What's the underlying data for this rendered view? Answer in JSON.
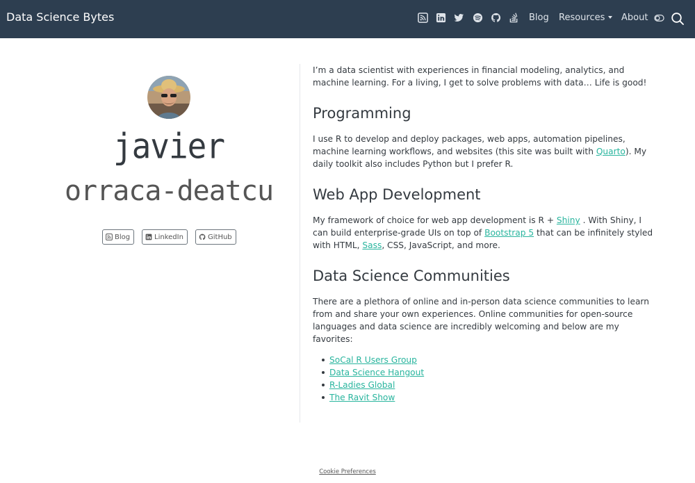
{
  "navbar": {
    "brand": "Data Science Bytes",
    "icons": [
      "rss-icon",
      "linkedin-icon",
      "twitter-icon",
      "spotify-icon",
      "github-icon",
      "stackoverflow-icon"
    ],
    "blog_label": "Blog",
    "resources_label": "Resources",
    "about_label": "About"
  },
  "profile": {
    "first_name": "javier",
    "last_name": "orraca-deatcu",
    "links": [
      {
        "label": "Blog",
        "icon": "rss-icon"
      },
      {
        "label": "LinkedIn",
        "icon": "linkedin-icon"
      },
      {
        "label": "GitHub",
        "icon": "github-icon"
      }
    ]
  },
  "content": {
    "intro": "I’m a data scientist with experiences in financial modeling, analytics, and machine learning. For a living, I get to solve problems with data… Life is good!",
    "programming": {
      "heading": "Programming",
      "text_before": "I use R to develop and deploy packages, web apps, automation pipelines, machine learning workflows, and websites (this site was built with ",
      "link": "Quarto",
      "text_after": "). My daily toolkit also includes Python but I prefer R."
    },
    "webapp": {
      "heading": "Web App Development",
      "text_1": "My framework of choice for web app development is R + ",
      "link_shiny": "Shiny",
      "text_2": " . With Shiny, I can build enterprise-grade UIs on top of ",
      "link_bootstrap": "Bootstrap 5",
      "text_3": " that can be infinitely styled with HTML, ",
      "link_sass": "Sass",
      "text_4": ", CSS, JavaScript, and more."
    },
    "communities": {
      "heading": "Data Science Communities",
      "text": "There are a plethora of online and in-person data science communities to learn from and share your own experiences. Online communities for open-source languages and data science are incredibly welcoming and below are my favorites:",
      "items": [
        "SoCal R Users Group",
        "Data Science Hangout",
        "R-Ladies Global",
        "The Ravit Show"
      ]
    }
  },
  "footer": {
    "cookie_label": "Cookie Preferences"
  },
  "colors": {
    "navbar_bg": "#2d3e50",
    "link": "#29b59e",
    "text": "#343a40"
  }
}
